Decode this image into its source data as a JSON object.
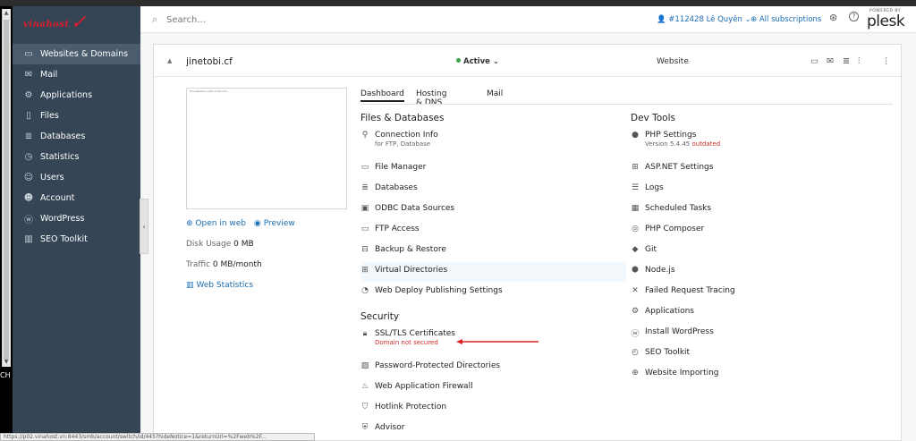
{
  "logo": {
    "text": "vinahost"
  },
  "sidebar": {
    "items": [
      {
        "label": "Websites & Domains",
        "icon": "monitor-icon",
        "active": true
      },
      {
        "label": "Mail",
        "icon": "mail-icon"
      },
      {
        "label": "Applications",
        "icon": "gear-icon"
      },
      {
        "label": "Files",
        "icon": "file-icon"
      },
      {
        "label": "Databases",
        "icon": "database-icon"
      },
      {
        "label": "Statistics",
        "icon": "clock-icon"
      },
      {
        "label": "Users",
        "icon": "user-icon"
      },
      {
        "label": "Account",
        "icon": "account-icon"
      },
      {
        "label": "WordPress",
        "icon": "wordpress-icon"
      },
      {
        "label": "SEO Toolkit",
        "icon": "chart-icon"
      }
    ]
  },
  "left_strip": {
    "label": "CH"
  },
  "header": {
    "search_placeholder": "Search...",
    "account": "#112428 Lê Quyên",
    "subscriptions": "All subscriptions",
    "plesk_powered": "POWERED BY",
    "plesk_brand": "plesk"
  },
  "domain": {
    "name": "jinetobi.cf",
    "status": "Active",
    "type": "Website",
    "preview_text": "This website is under construction",
    "open_in_web": "Open in web",
    "preview": "Preview",
    "disk_label": "Disk Usage",
    "disk_value": "0 MB",
    "traffic_label": "Traffic",
    "traffic_value": "0 MB/month",
    "web_stats": "Web Statistics"
  },
  "tabs": [
    "Dashboard",
    "Hosting & DNS",
    "Mail"
  ],
  "files_databases": {
    "title": "Files & Databases",
    "items": [
      {
        "label": "Connection Info",
        "sub": "for FTP, Database"
      },
      {
        "label": "File Manager"
      },
      {
        "label": "Databases"
      },
      {
        "label": "ODBC Data Sources"
      },
      {
        "label": "FTP Access"
      },
      {
        "label": "Backup & Restore"
      },
      {
        "label": "Virtual Directories"
      },
      {
        "label": "Web Deploy Publishing Settings"
      }
    ]
  },
  "security": {
    "title": "Security",
    "items": [
      {
        "label": "SSL/TLS Certificates",
        "sub": "Domain not secured"
      },
      {
        "label": "Password-Protected Directories"
      },
      {
        "label": "Web Application Firewall"
      },
      {
        "label": "Hotlink Protection"
      },
      {
        "label": "Advisor"
      }
    ]
  },
  "dev_tools": {
    "title": "Dev Tools",
    "items": [
      {
        "label": "PHP Settings",
        "sub": "Version 5.4.45",
        "sub_red": "outdated"
      },
      {
        "label": "ASP.NET Settings"
      },
      {
        "label": "Logs"
      },
      {
        "label": "Scheduled Tasks"
      },
      {
        "label": "PHP Composer"
      },
      {
        "label": "Git"
      },
      {
        "label": "Node.js"
      },
      {
        "label": "Failed Request Tracing"
      },
      {
        "label": "Applications"
      },
      {
        "label": "Install WordPress"
      },
      {
        "label": "SEO Toolkit"
      },
      {
        "label": "Website Importing"
      }
    ]
  },
  "status_url": "https://p02.vinahost.vn:8443/smb/account/switch/id/445?hideNotice=1&returnUrl=%2Fweb%2F...",
  "colors": {
    "sidebar": "#354555",
    "link": "#1a6db3",
    "warning": "#d02c2c",
    "active_dot": "#3fa14a"
  }
}
